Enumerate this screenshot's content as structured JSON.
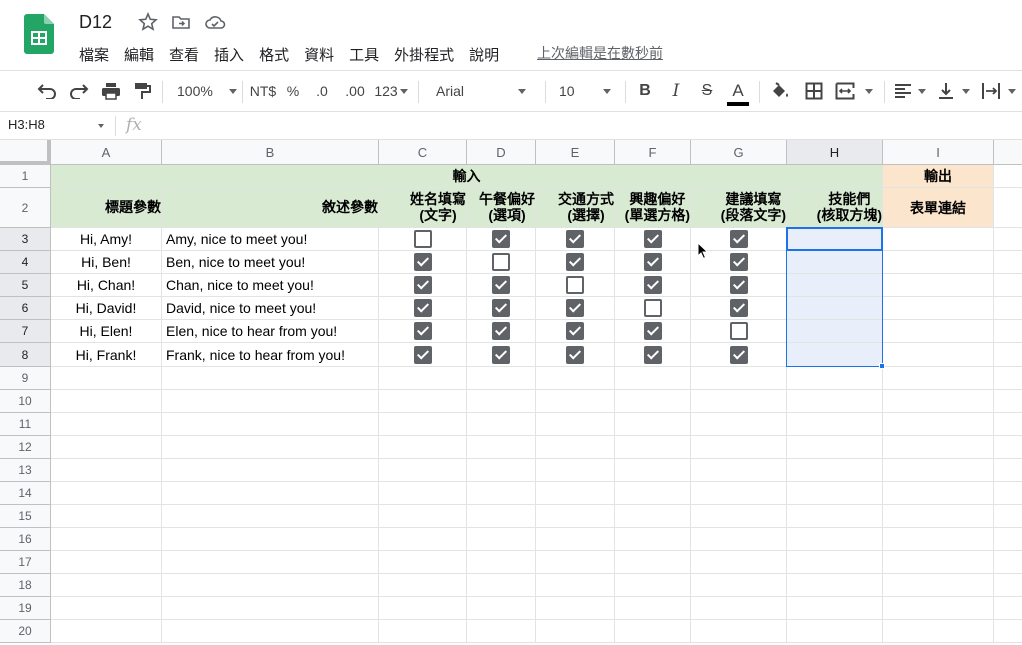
{
  "doc": {
    "title": "D12",
    "last_edit": "上次編輯是在數秒前"
  },
  "menu": [
    "檔案",
    "編輯",
    "查看",
    "插入",
    "格式",
    "資料",
    "工具",
    "外掛程式",
    "說明"
  ],
  "toolbar": {
    "zoom": "100%",
    "currency": "NT$",
    "percent": "%",
    "dec_less": ".0",
    "dec_more": ".00",
    "format_more": "123",
    "font": "Arial",
    "font_size": "10",
    "bold": "B",
    "italic": "I",
    "strike": "S",
    "text_color_letter": "A"
  },
  "formula_bar": {
    "name_box": "H3:H8",
    "fx": "fx",
    "value": ""
  },
  "columns": [
    "A",
    "B",
    "C",
    "D",
    "E",
    "F",
    "G",
    "H",
    "I"
  ],
  "rows": [
    "1",
    "2",
    "3",
    "4",
    "5",
    "6",
    "7",
    "8",
    "9",
    "10",
    "11",
    "12",
    "13",
    "14",
    "15",
    "16",
    "17",
    "18",
    "19",
    "20"
  ],
  "sheet": {
    "input_label": "輸入",
    "output_label": "輸出",
    "headers": {
      "A": "標題參數",
      "B": "敘述參數",
      "C": "姓名填寫\n(文字)",
      "D": "午餐偏好\n(選項)",
      "E": "交通方式\n(選擇)",
      "F": "興趣偏好\n(單選方格)",
      "G": "建議填寫\n(段落文字)",
      "H": "技能們\n(核取方塊)",
      "I": "表單連結"
    },
    "data": [
      {
        "a": "Hi, Amy!",
        "b": "Amy, nice to meet you!",
        "checks": [
          false,
          true,
          true,
          true,
          true
        ]
      },
      {
        "a": "Hi, Ben!",
        "b": "Ben, nice to meet you!",
        "checks": [
          true,
          false,
          true,
          true,
          true
        ]
      },
      {
        "a": "Hi, Chan!",
        "b": "Chan, nice to meet you!",
        "checks": [
          true,
          true,
          false,
          true,
          true
        ]
      },
      {
        "a": "Hi, David!",
        "b": "David, nice to meet you!",
        "checks": [
          true,
          true,
          true,
          false,
          true
        ]
      },
      {
        "a": "Hi, Elen!",
        "b": "Elen, nice to hear from you!",
        "checks": [
          true,
          true,
          true,
          true,
          false
        ]
      },
      {
        "a": "Hi, Frank!",
        "b": "Frank, nice to hear from you!",
        "checks": [
          true,
          true,
          true,
          true,
          true
        ]
      }
    ]
  },
  "colors": {
    "input_bg": "#d9ead3",
    "output_bg": "#fce5cd",
    "selection": "#1a73e8"
  }
}
